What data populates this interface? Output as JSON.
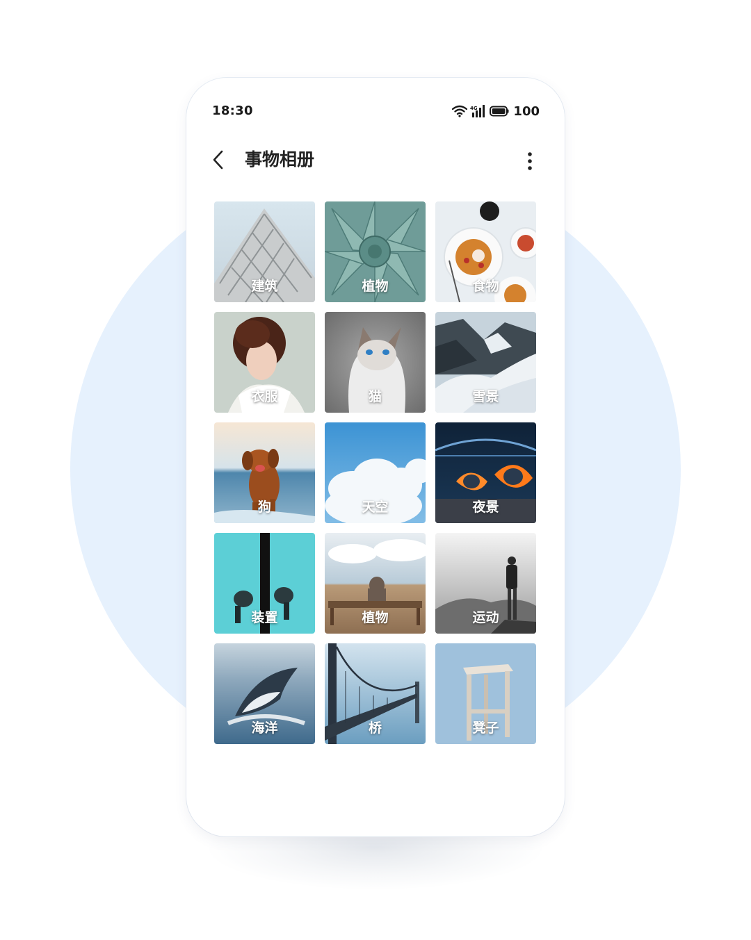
{
  "status_bar": {
    "time": "18:30",
    "network_label": "4G",
    "battery": "100",
    "icons": [
      "wifi-icon",
      "signal-icon",
      "battery-icon"
    ]
  },
  "app_bar": {
    "title": "事物相册",
    "back_icon": "chevron-left-icon",
    "more_icon": "more-vertical-icon"
  },
  "albums": [
    {
      "label": "建筑",
      "subject": "building"
    },
    {
      "label": "植物",
      "subject": "succulent"
    },
    {
      "label": "食物",
      "subject": "food"
    },
    {
      "label": "衣服",
      "subject": "portrait"
    },
    {
      "label": "猫",
      "subject": "cat"
    },
    {
      "label": "雪景",
      "subject": "snow-mountain"
    },
    {
      "label": "狗",
      "subject": "dog-beach"
    },
    {
      "label": "天空",
      "subject": "sky-clouds"
    },
    {
      "label": "夜景",
      "subject": "night-bridge"
    },
    {
      "label": "装置",
      "subject": "installation"
    },
    {
      "label": "植物",
      "subject": "bench-field"
    },
    {
      "label": "运动",
      "subject": "hiker"
    },
    {
      "label": "海洋",
      "subject": "whale"
    },
    {
      "label": "桥",
      "subject": "bridge"
    },
    {
      "label": "凳子",
      "subject": "stool"
    }
  ],
  "colors": {
    "background_circle": "#e6f1fd",
    "phone_body": "#ffffff",
    "title_text": "#222222",
    "label_text": "#ffffff"
  }
}
